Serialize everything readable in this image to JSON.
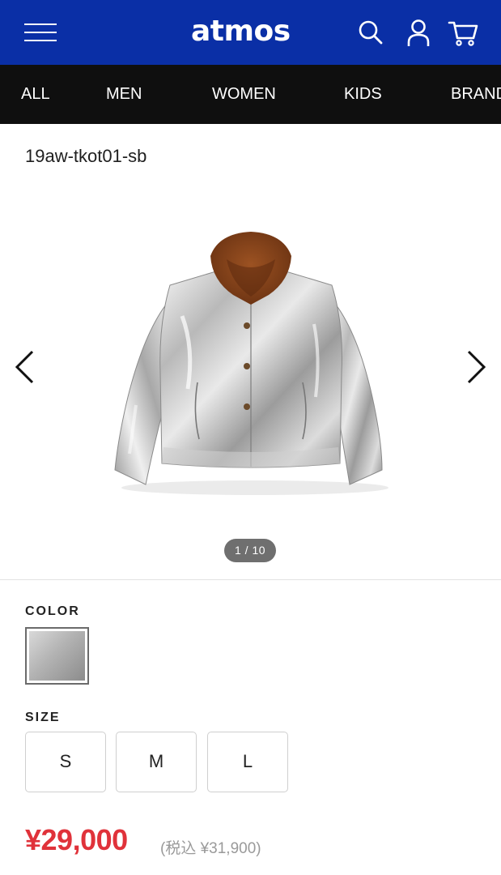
{
  "header": {
    "logo_text": "atmos",
    "background_color": "#0a2fa6",
    "icons": [
      "menu-icon",
      "search-icon",
      "account-icon",
      "cart-icon"
    ]
  },
  "category_nav": {
    "items": [
      {
        "label": "ALL"
      },
      {
        "label": "MEN"
      },
      {
        "label": "WOMEN"
      },
      {
        "label": "KIDS"
      },
      {
        "label": "BRAND"
      }
    ]
  },
  "product": {
    "code": "19aw-tkot01-sb",
    "image_counter": "1 / 10",
    "color_label": "COLOR",
    "size_label": "SIZE",
    "sizes": [
      "S",
      "M",
      "L"
    ],
    "price": "¥29,000",
    "price_tax_included": "(税込 ¥31,900)",
    "price_color": "#e0323a"
  }
}
